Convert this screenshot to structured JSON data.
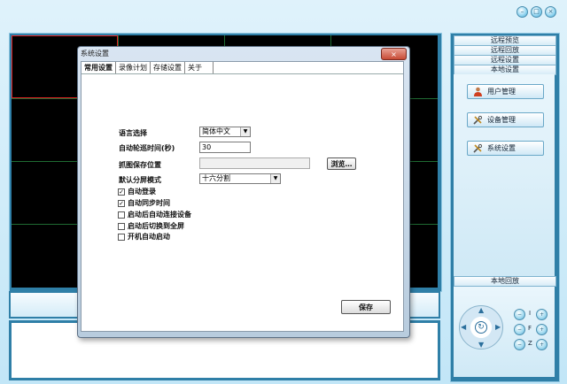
{
  "window_controls": [
    {
      "name": "minimize",
      "glyph": "–"
    },
    {
      "name": "restore",
      "glyph": "□"
    },
    {
      "name": "close",
      "glyph": "×"
    }
  ],
  "right_panel": {
    "tabs": [
      "远程预览",
      "远程回放",
      "远程设置",
      "本地设置"
    ],
    "buttons": [
      "用户管理",
      "设备管理",
      "系统设置"
    ],
    "bottom_tab": "本地回放",
    "ptz_labels": [
      "I",
      "F",
      "Z"
    ]
  },
  "dialog": {
    "title": "系统设置",
    "close_glyph": "×",
    "tabs": [
      "常用设置",
      "录像计划",
      "存储设置",
      "关于"
    ],
    "language_label": "语言选择",
    "language_value": "简体中文",
    "poll_label": "自动轮巡时间(秒)",
    "poll_value": "30",
    "snapshot_label": "抓图保存位置",
    "snapshot_value": "",
    "browse_label": "浏览…",
    "split_label": "默认分屏模式",
    "split_value": "十六分割",
    "checkboxes": [
      {
        "label": "自动登录",
        "checked": true
      },
      {
        "label": "自动同步时间",
        "checked": true
      },
      {
        "label": "启动后自动连接设备",
        "checked": false
      },
      {
        "label": "启动后切换到全屏",
        "checked": false
      },
      {
        "label": "开机自动启动",
        "checked": false
      }
    ],
    "save_label": "保存"
  },
  "colors": {
    "grid_line": "#1f6b33",
    "selected_cell": "#e02020",
    "panel_frame": "#2f7fa7"
  }
}
